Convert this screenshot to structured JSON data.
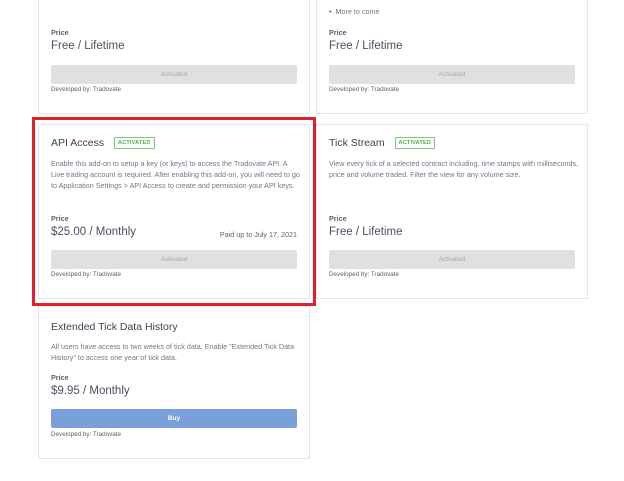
{
  "cards": {
    "top_left": {
      "price_label": "Price",
      "price_value": "Free / Lifetime",
      "button_label": "Activated",
      "developer": "Developed by: Tradovate"
    },
    "top_right": {
      "bullet": "More to come",
      "price_label": "Price",
      "price_value": "Free / Lifetime",
      "button_label": "Activated",
      "developer": "Developed by: Tradovate"
    },
    "api_access": {
      "title": "API Access",
      "badge": "ACTIVATED",
      "description": "Enable this add-on to setup a key (or keys) to access the Tradovate API. A Live trading account is required. After enabling this add-on, you will need to go to Application Settings > API Access to create and permission your API keys.",
      "price_label": "Price",
      "price_value": "$25.00 / Monthly",
      "paid_up": "Paid up to July 17, 2021",
      "button_label": "Activated",
      "developer": "Developed by: Tradovate"
    },
    "tick_stream": {
      "title": "Tick Stream",
      "badge": "ACTIVATED",
      "description": "View every tick of a selected contract including, time stamps with milliseconds, price and volume traded. Filter the view for any volume size.",
      "price_label": "Price",
      "price_value": "Free / Lifetime",
      "button_label": "Activated",
      "developer": "Developed by: Tradovate"
    },
    "extended_tick": {
      "title": "Extended Tick Data History",
      "description": "All users have access to two weeks of tick data. Enable \"Extended Tick Data History\" to access one year of tick data.",
      "price_label": "Price",
      "price_value": "$9.95 / Monthly",
      "button_label": "Buy",
      "developer": "Developed by: Tradovate"
    }
  },
  "colors": {
    "highlight": "#e0202a",
    "buy_button": "#7b9fd8",
    "badge": "#4cae4c",
    "disabled_button": "#e0e0e0"
  }
}
